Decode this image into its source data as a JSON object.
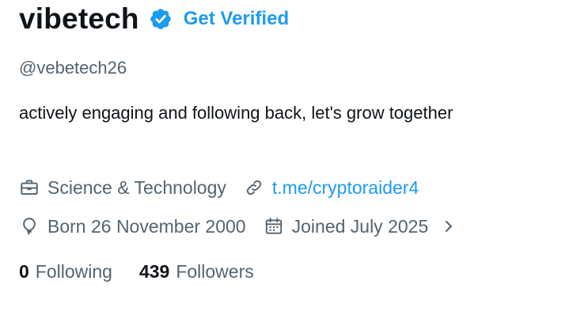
{
  "profile": {
    "display_name": "vibetech",
    "get_verified_label": "Get Verified",
    "handle": "@vebetech26",
    "bio": "actively engaging and following back, let's grow together",
    "category": "Science & Technology",
    "website": "t.me/cryptoraider4",
    "birthday": "Born 26 November 2000",
    "joined": "Joined July 2025",
    "following_count": "0",
    "following_label": "Following",
    "followers_count": "439",
    "followers_label": "Followers"
  },
  "icons": {
    "verified": "verified-badge-icon",
    "category": "briefcase-icon",
    "website": "link-icon",
    "birthday": "balloon-icon",
    "joined": "calendar-icon",
    "expand": "chevron-right-icon"
  },
  "colors": {
    "accent": "#1d9bf0",
    "primary_text": "#0f1419",
    "secondary_text": "#536471",
    "background": "#ffffff"
  }
}
